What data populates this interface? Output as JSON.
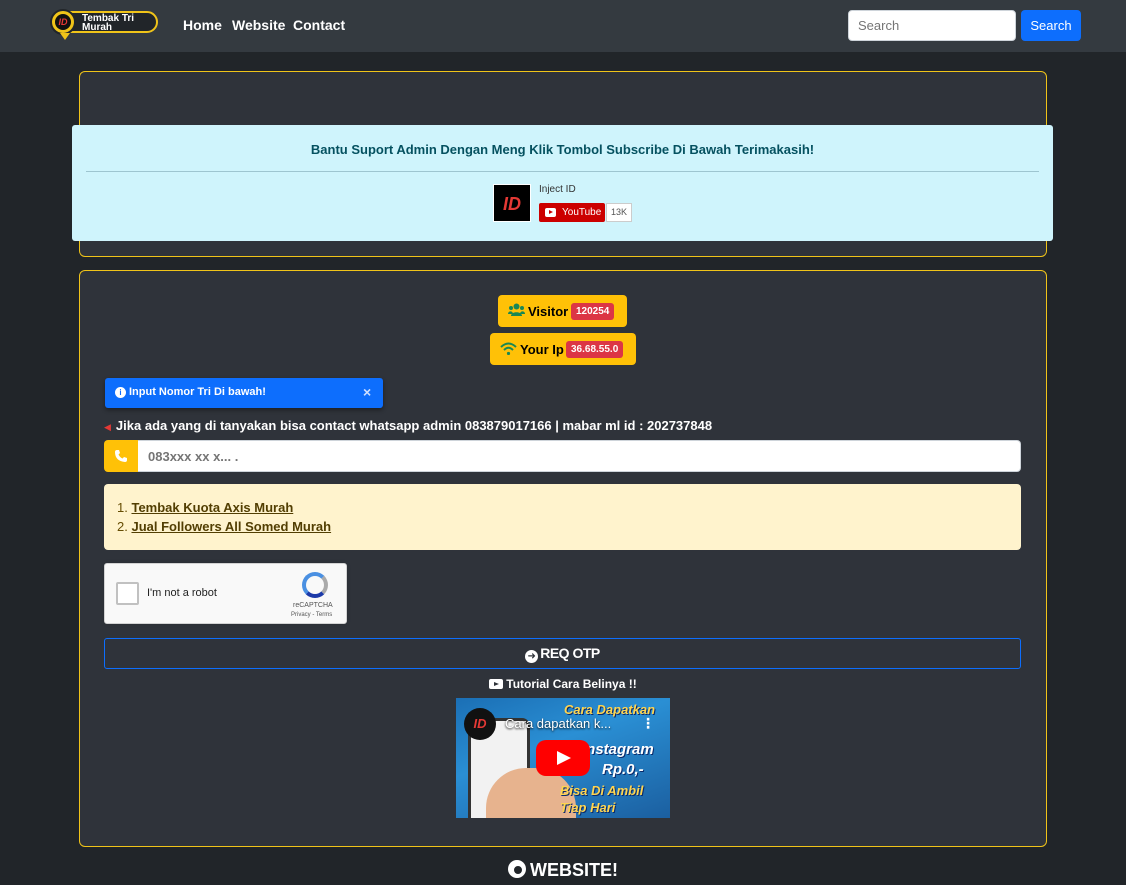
{
  "navbar": {
    "brand_text": "Tembak Tri Murah",
    "brand_logo_text": "ID",
    "links": [
      "Home",
      "Website",
      "Contact"
    ],
    "search_placeholder": "Search",
    "search_button": "Search"
  },
  "support_alert": {
    "title": "Bantu Suport Admin Dengan Meng Klik Tombol Subscribe Di Bawah Terimakasih!",
    "avatar_text": "ID",
    "channel_name": "Inject ID",
    "youtube_label": "YouTube",
    "subscriber_count": "13K"
  },
  "stats": {
    "visitor_label": "Visitor",
    "visitor_count": "120254",
    "ip_label": "Your Ip",
    "ip_value": "36.68.55.0"
  },
  "toast": {
    "text": "Input Nomor Tri Di bawah!",
    "close": "×"
  },
  "contact_line": "Jika ada yang di tanyakan bisa contact whatsapp admin 083879017166 | mabar ml id : 202737848",
  "phone_input": {
    "placeholder": "083xxx xx x... ."
  },
  "links": [
    {
      "number": "1.",
      "label": "Tembak Kuota Axis Murah"
    },
    {
      "number": "2.",
      "label": "Jual Followers All Somed Murah"
    }
  ],
  "recaptcha": {
    "label": "I'm not a robot",
    "brand": "reCAPTCHA",
    "terms": "Privacy - Terms"
  },
  "otp_button": "REQ OTP",
  "tutorial_label": "Tutorial Cara Belinya !!",
  "video": {
    "channel_avatar": "ID",
    "title": "Cara dapatkan k...",
    "overlay_1": "Cara Dapatkan",
    "overlay_2": "Instagram",
    "overlay_3": "Rp.0,-",
    "overlay_4": "Bisa Di Ambil",
    "overlay_5": "Tiap Hari"
  },
  "website_heading": "WEBSITE!",
  "colors": {
    "accent_yellow": "#ffc107",
    "primary_blue": "#0d6efd",
    "badge_red": "#dc3545",
    "background": "#212529"
  }
}
